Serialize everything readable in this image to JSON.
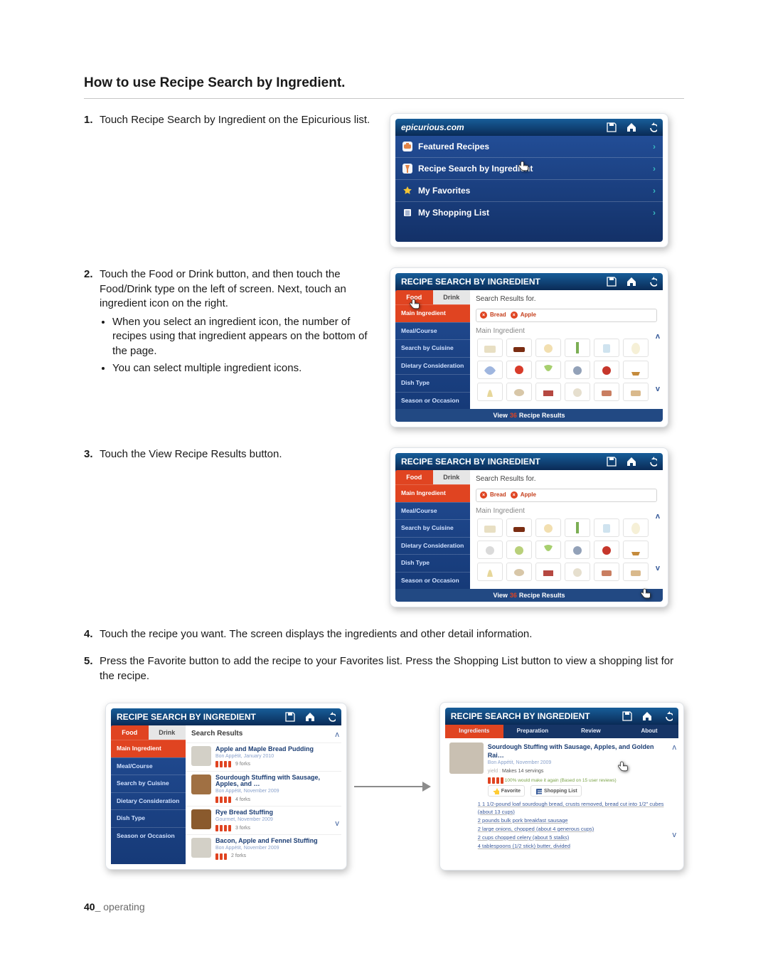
{
  "page": {
    "title": "How to use Recipe Search by Ingredient.",
    "footer_number": "40_",
    "footer_label": " operating"
  },
  "steps": {
    "s1": {
      "num": "1.",
      "text": "Touch Recipe Search by Ingredient on the Epicurious list."
    },
    "s2": {
      "num": "2.",
      "text": "Touch the Food or Drink button, and then touch the Food/Drink type on the left of screen. Next, touch an ingredient icon on the right.",
      "b1": "When you select an ingredient icon, the number of recipes using that ingredient appears on the bottom of the page.",
      "b2": "You can select multiple ingredient icons."
    },
    "s3": {
      "num": "3.",
      "text": "Touch the View Recipe Results button."
    },
    "s4": {
      "num": "4.",
      "text": "Touch the recipe you want. The screen displays the ingredients and other detail information."
    },
    "s5": {
      "num": "5.",
      "text": "Press the Favorite button to add the recipe to your Favorites list. Press the Shopping List button to view a shopping list for the recipe."
    }
  },
  "colors": {
    "orange": "#e04421",
    "blue": "#1f3d74",
    "cyan": "#39bbc1",
    "gold": "#c9a500"
  },
  "icons": {
    "save": "save-icon",
    "home": "home-icon",
    "back": "back-icon",
    "pot": "pot-icon",
    "glass": "glass-icon",
    "star": "star-icon",
    "listpad": "list-icon",
    "hand": "hand-pointer-icon",
    "scroll-up": "chevron-up-icon",
    "scroll-down": "chevron-down-icon",
    "favorite-btn": "star-icon",
    "shopping-btn": "shopping-list-icon",
    "arrow": "arrow-right-icon",
    "close-chip": "close-icon",
    "fork": "fork-icon"
  },
  "epi_home": {
    "title": "epicurious.com",
    "items": [
      {
        "icon": "pot",
        "label": "Featured Recipes"
      },
      {
        "icon": "glass",
        "label": "Recipe Search by Ingredient"
      },
      {
        "icon": "star",
        "label": "My Favorites"
      },
      {
        "icon": "listpad",
        "label": "My Shopping List"
      }
    ]
  },
  "rs_common": {
    "top_title": "RECIPE SEARCH BY INGREDIENT",
    "tabs": {
      "food": "Food",
      "drink": "Drink"
    },
    "search_for": "Search Results for.",
    "chips": [
      "Bread",
      "Apple"
    ],
    "sub_label": "Main Ingredient",
    "sidebar": [
      "Main Ingredient",
      "Meal/Course",
      "Search by Cuisine",
      "Dietary Consideration",
      "Dish Type",
      "Season or Occasion"
    ],
    "footer_prefix": "View ",
    "footer_count": "36",
    "footer_suffix": " Recipe Results"
  },
  "results": {
    "top_title": "RECIPE SEARCH BY INGREDIENT",
    "header": "Search Results",
    "items": [
      {
        "t": "Apple and Maple Bread Pudding",
        "src": "Bon Appétit, January 2010",
        "forks": 4,
        "votes": "9 forks"
      },
      {
        "t": "Sourdough Stuffing with Sausage, Apples, and …",
        "src": "Bon Appétit, November 2009",
        "forks": 4,
        "votes": "4 forks"
      },
      {
        "t": "Rye Bread Stuffing",
        "src": "Gourmet, November 2009",
        "forks": 4,
        "votes": "3 forks"
      },
      {
        "t": "Bacon, Apple and Fennel Stuffing",
        "src": "Bon Appétit, November 2009",
        "forks": 3,
        "votes": "2 forks"
      }
    ]
  },
  "detail": {
    "top_title": "RECIPE SEARCH BY INGREDIENT",
    "tabs": [
      "Ingredients",
      "Preparation",
      "Review",
      "About"
    ],
    "active_tab": 0,
    "title": "Sourdough Stuffing with Sausage, Apples, and Golden Rai…",
    "source": "Bon Appétit, November 2009",
    "yield_label": "yield : ",
    "yield_value": "Makes 14 servings",
    "again": "100% would make it again  (Based on 15 user reviews)",
    "btn_fav": "Favorite",
    "btn_shop": "Shopping List",
    "ingredients": [
      "1 1 1/2-pound loaf sourdough bread, crusts removed, bread cut into 1/2\" cubes (about 13 cups)",
      "2 pounds bulk pork breakfast sausage",
      "2 large onions, chopped (about 4 generous cups)",
      "2 cups chopped celery (about 5 stalks)",
      "4 tablespoons (1/2 stick) butter, divided"
    ]
  }
}
